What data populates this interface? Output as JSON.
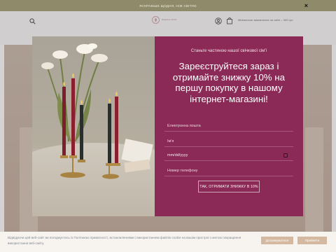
{
  "promo": {
    "text": "ЯСКРАВІШЕ ЩОДНЯ, НІЖ СВІТЛО",
    "close_label": "×"
  },
  "header": {
    "logo_text": "ВОДЯНА ЛІЛІЯ",
    "icons": [
      "search-icon",
      "user-icon",
      "bag-icon"
    ],
    "shipping_text": "Мінімальне замовлення на сайті – 300 грн"
  },
  "modal": {
    "kicker": "Станьте частиною нашої свічкової сім'ї",
    "headline": "Зареєструйтеся зараз і отримайте знижку 10% на першу покупку в нашому інтернет-магазині!",
    "email_placeholder": "Електронна пошта",
    "name_placeholder": "Ім'я",
    "date_value": "mm/dd/yyyy",
    "phone_placeholder": "Номер телефону",
    "submit_label": "ТАК, ОТРИМАТИ ЗНИЖКУ В 10%",
    "accent_color": "#8b2a56"
  },
  "cookie": {
    "text": "Відвідуючи цей веб-сайт ви погоджуєтесь із Політикою приватності, встановленнями і використанням файлів cookie на вашім пристрої з метою покращення використання веб-сайту.",
    "accept_label": "Дотримуватися",
    "reject_label": "Прийняти"
  }
}
